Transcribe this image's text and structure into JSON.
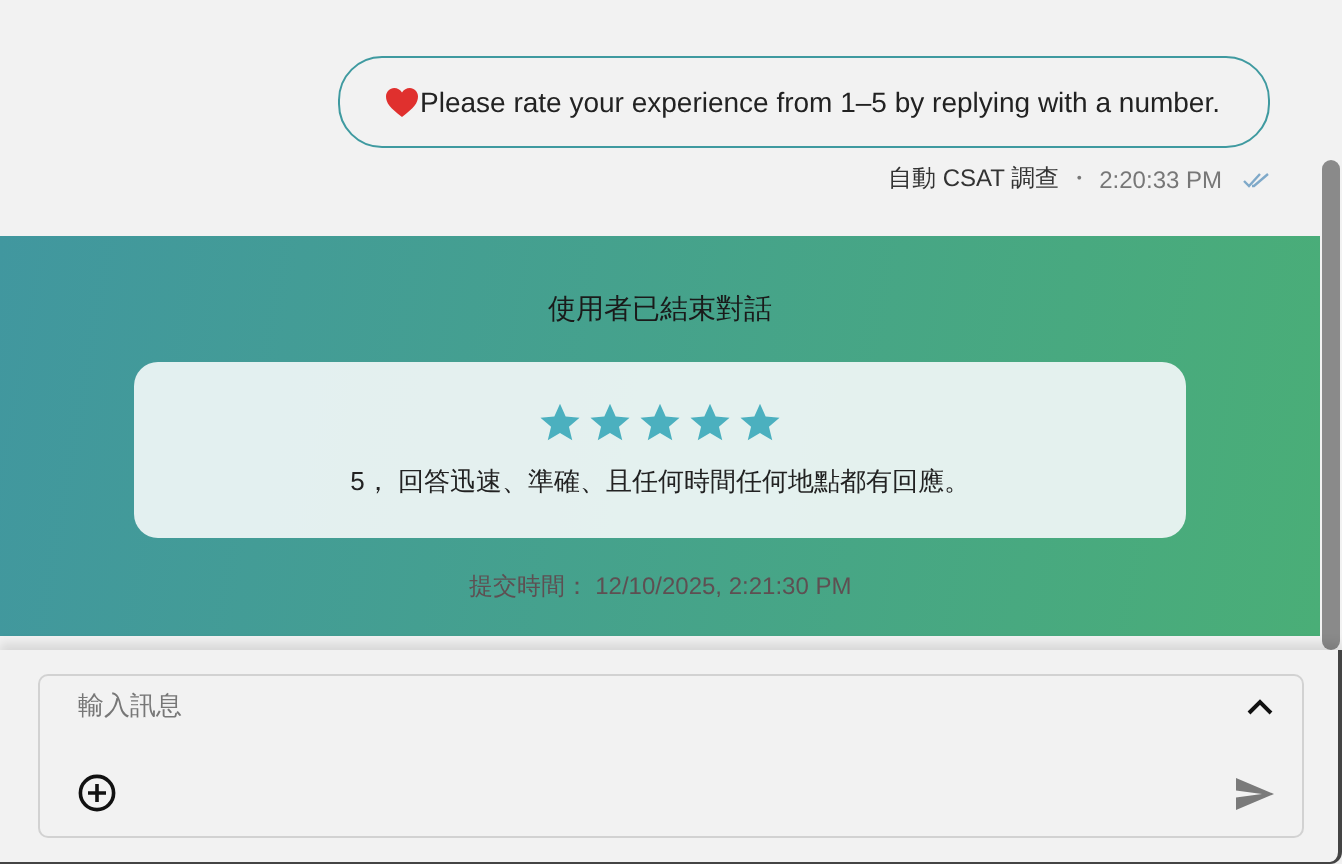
{
  "message": {
    "text": "Please rate your experience from 1–5 by replying with a number.",
    "sender": "自動 CSAT 調查",
    "separator": "・",
    "time": "2:20:33 PM"
  },
  "ended_banner": {
    "title": "使用者已結束對話",
    "rating": {
      "stars": 5,
      "comment": "5， 回答迅速、準確、且任何時間任何地點都有回應。"
    },
    "submitted": "提交時間： 12/10/2025, 2:21:30 PM"
  },
  "composer": {
    "placeholder": "輸入訊息"
  }
}
